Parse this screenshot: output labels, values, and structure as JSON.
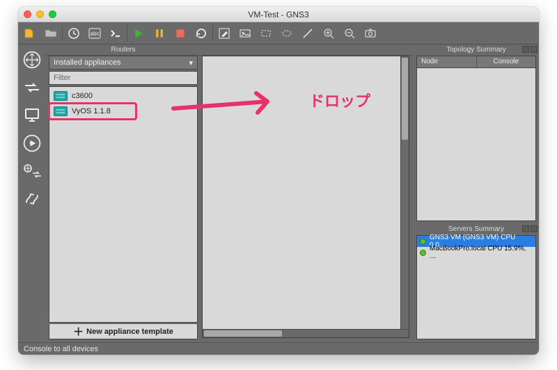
{
  "window": {
    "title": "VM-Test - GNS3"
  },
  "panel": {
    "title": "Routers",
    "dropdown": "Installed appliances",
    "filter_placeholder": "Filter",
    "devices": [
      "c3600",
      "VyOS 1.1.8"
    ],
    "highlighted_index": 1,
    "new_template": "New appliance template"
  },
  "topology": {
    "title": "Topology Summary",
    "columns": [
      "Node",
      "Console"
    ]
  },
  "servers": {
    "title": "Servers Summary",
    "rows": [
      {
        "label": "GNS3 VM (GNS3 VM) CPU 0.0…",
        "selected": true
      },
      {
        "label": "MacBookPro.local CPU 15.9%, …",
        "selected": false
      }
    ]
  },
  "status": "Console to all devices",
  "annotation": {
    "text": "ドロップ"
  }
}
